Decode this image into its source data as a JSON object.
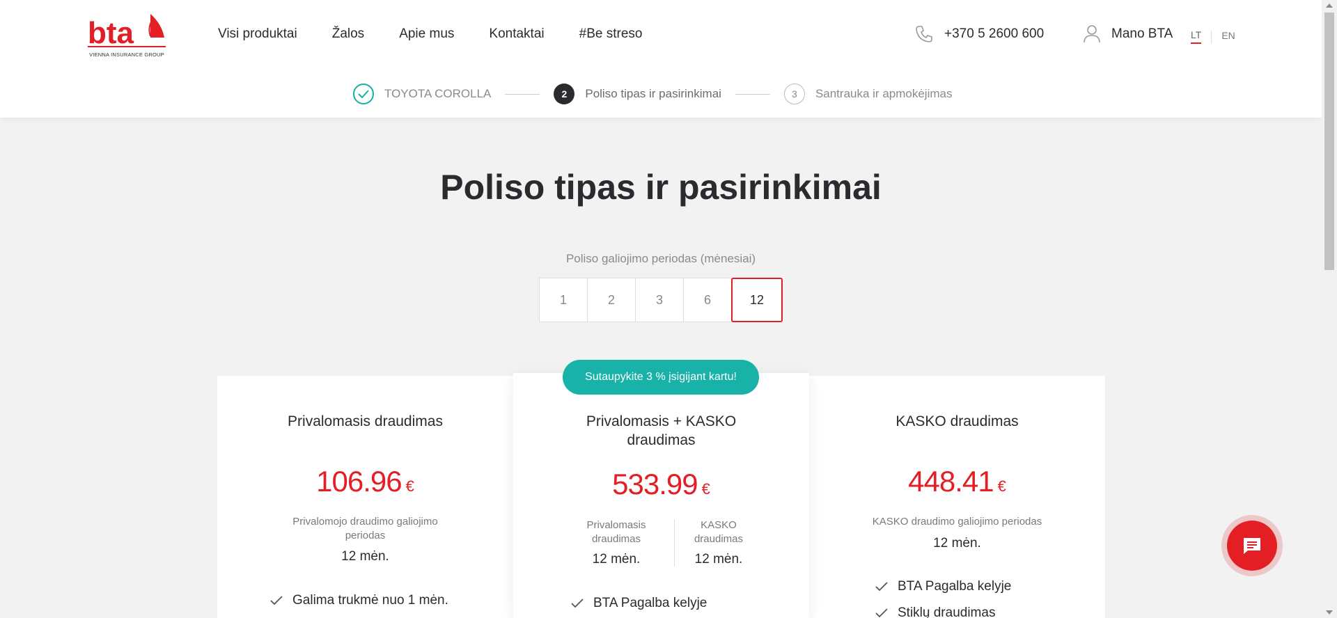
{
  "header": {
    "logo_text": "bta",
    "logo_sub": "VIENNA INSURANCE GROUP",
    "nav": [
      "Visi produktai",
      "Žalos",
      "Apie mus",
      "Kontaktai",
      "#Be streso"
    ],
    "phone": "+370 5 2600 600",
    "account": "Mano BTA",
    "languages": {
      "active": "LT",
      "other": "EN"
    }
  },
  "stepper": {
    "steps": [
      {
        "number": "1",
        "label": "TOYOTA COROLLA",
        "state": "done"
      },
      {
        "number": "2",
        "label": "Poliso tipas ir pasirinkimai",
        "state": "current"
      },
      {
        "number": "3",
        "label": "Santrauka ir apmokėjimas",
        "state": "todo"
      }
    ]
  },
  "main": {
    "title": "Poliso tipas ir pasirinkimai",
    "period_label": "Poliso galiojimo periodas (mėnesiai)",
    "periods": [
      "1",
      "2",
      "3",
      "6",
      "12"
    ],
    "selected_period": "12",
    "badge": "Sutaupykite 3 % įsigijant kartu!",
    "cards": [
      {
        "title": "Privalomasis draudimas",
        "price": "106.96",
        "currency": "€",
        "period_label": "Privalomojo draudimo galiojimo periodas",
        "period_value": "12 mėn.",
        "features": [
          "Galima trukmė nuo 1 mėn."
        ]
      },
      {
        "title": "Privalomasis + KASKO draudimas",
        "price": "533.99",
        "currency": "€",
        "split": [
          {
            "label": "Privalomasis draudimas",
            "value": "12 mėn."
          },
          {
            "label": "KASKO draudimas",
            "value": "12 mėn."
          }
        ],
        "features": [
          "BTA Pagalba kelyje"
        ]
      },
      {
        "title": "KASKO draudimas",
        "price": "448.41",
        "currency": "€",
        "period_label": "KASKO draudimo galiojimo periodas",
        "period_value": "12 mėn.",
        "features": [
          "BTA Pagalba kelyje",
          "Stiklų draudimas"
        ]
      }
    ]
  },
  "colors": {
    "brand_red": "#e31e24",
    "teal": "#18b2a9",
    "dark": "#2b2b2f"
  },
  "icons": {
    "phone": "phone-icon",
    "user": "user-icon",
    "check": "check-icon",
    "chat": "chat-icon"
  }
}
